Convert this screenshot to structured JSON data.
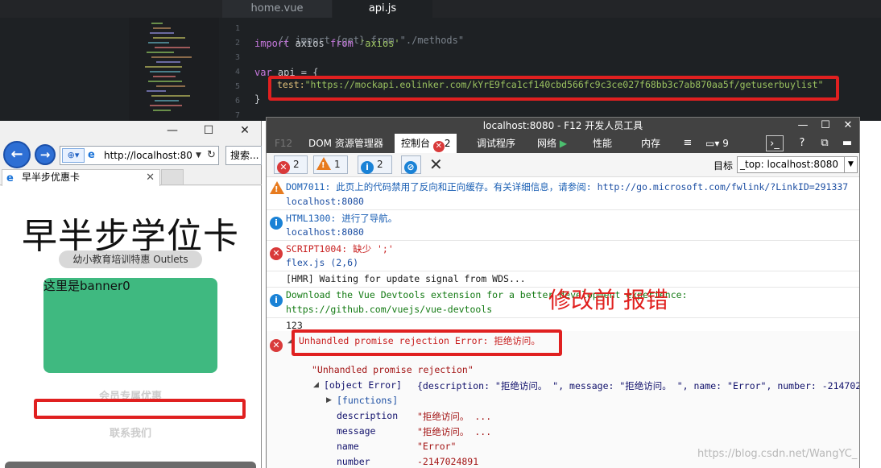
{
  "editor": {
    "tabs": [
      "home.vue",
      "api.js"
    ],
    "line_numbers": [
      "1",
      "2",
      "3",
      "4",
      "5",
      "6",
      "7"
    ],
    "code": {
      "l1": "// import {get} from \"./methods\"",
      "l2_kw": "import",
      "l2_mid": " axios ",
      "l2_from": "from",
      "l2_str": " 'axios'",
      "l4_kw": "var",
      "l4_rest": " api = {",
      "l5_prop": "test:",
      "l5_str": "\"https://mockapi.eolinker.com/kYrE9fca1cf140cbd566fc9c3ce027f68bb3c7ab870aa5f/getuserbuylist\"",
      "l6": "}"
    }
  },
  "browser": {
    "window_controls": [
      "—",
      "☐",
      "✕"
    ],
    "address": "http://localhost:80",
    "search_placeholder": "搜索...",
    "tab_label": "早半步优惠卡",
    "tab_close": "✕",
    "page": {
      "title": "早半步学位卡",
      "subtitle": "幼小教育培训特惠 Outlets",
      "banner_text": "这里是banner0",
      "member_label": "会员专属优惠",
      "contact_label": "联系我们"
    }
  },
  "devtools": {
    "title": "localhost:8080 - F12 开发人员工具",
    "window_controls": [
      "—",
      "☐",
      "✕"
    ],
    "tabs": {
      "f12": "F12",
      "dom": "DOM 资源管理器",
      "console": "控制台",
      "console_errors": "2",
      "debugger": "调试程序",
      "network": "网络",
      "performance": "性能",
      "memory": "内存",
      "emulation_count": "9"
    },
    "filters": {
      "errors": "2",
      "warnings": "1",
      "info": "2"
    },
    "target_label": "目标",
    "target_value": "_top: localhost:8080",
    "messages": {
      "m1_text": "DOM7011: 此页上的代码禁用了反向和正向缓存。有关详细信息，请参阅: ",
      "m1_link": "http://go.microsoft.com/fwlink/?LinkID=291337",
      "m1_src": "localhost:8080",
      "m2_text": "HTML1300: 进行了导航。",
      "m2_src": "localhost:8080",
      "m3_text": "SCRIPT1004: 缺少 ';'",
      "m3_src": "flex.js (2,6)",
      "m4_text": "[HMR] Waiting for update signal from WDS...",
      "m5_text": "Download the Vue Devtools extension for a better development experience:",
      "m5_link": "https://github.com/vuejs/vue-devtools",
      "m6_text": "123",
      "err_title": "Unhandled promise rejection Error: 拒绝访问。",
      "err_string": "\"Unhandled promise rejection\"",
      "obj_label": "[object Error]",
      "obj_value": "{description: \"拒绝访问。 \", message: \"拒绝访问。 \", name: \"Error\", number: -21470248",
      "functions": "[functions]",
      "props": [
        {
          "key": "description",
          "value": "\"拒绝访问。 ..."
        },
        {
          "key": "message",
          "value": "\"拒绝访问。 ..."
        },
        {
          "key": "name",
          "value": "\"Error\""
        },
        {
          "key": "number",
          "value": "-2147024891"
        }
      ]
    }
  },
  "annotation": "修改前 报错",
  "watermark": "https://blog.csdn.net/WangYC_",
  "colors": {
    "annotation_red": "#e02020",
    "banner_green": "#3fb980",
    "error_red": "#c81e1e"
  }
}
